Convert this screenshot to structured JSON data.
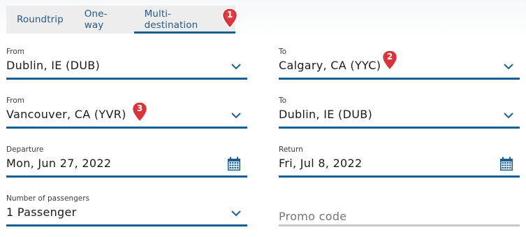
{
  "tabs": [
    {
      "label": "Roundtrip",
      "active": false
    },
    {
      "label": "One-way",
      "active": false
    },
    {
      "label": "Multi-destination",
      "active": true
    }
  ],
  "flights": [
    {
      "from": {
        "label": "From",
        "value": "Dublin, IE (DUB)"
      },
      "to": {
        "label": "To",
        "value": "Calgary, CA (YYC)"
      }
    },
    {
      "from": {
        "label": "From",
        "value": "Vancouver, CA (YVR)"
      },
      "to": {
        "label": "To",
        "value": "Dublin, IE (DUB)"
      }
    }
  ],
  "dates": {
    "departure": {
      "label": "Departure",
      "value": "Mon, Jun 27, 2022"
    },
    "return": {
      "label": "Return",
      "value": "Fri, Jul 8, 2022"
    }
  },
  "passengers": {
    "label": "Number of passengers",
    "value": "1 Passenger"
  },
  "promo": {
    "placeholder": "Promo code"
  },
  "markers": [
    "1",
    "2",
    "3"
  ],
  "colors": {
    "accent": "#1a5f92",
    "tab_text": "#2a5a82",
    "tab_bg": "#ededed",
    "marker_red": "#d9343a",
    "inactive_underline": "#c8c8c8"
  },
  "icons": {
    "dropdown": "chevron-down-icon",
    "calendar": "calendar-icon",
    "marker": "map-pin-marker-icon"
  }
}
